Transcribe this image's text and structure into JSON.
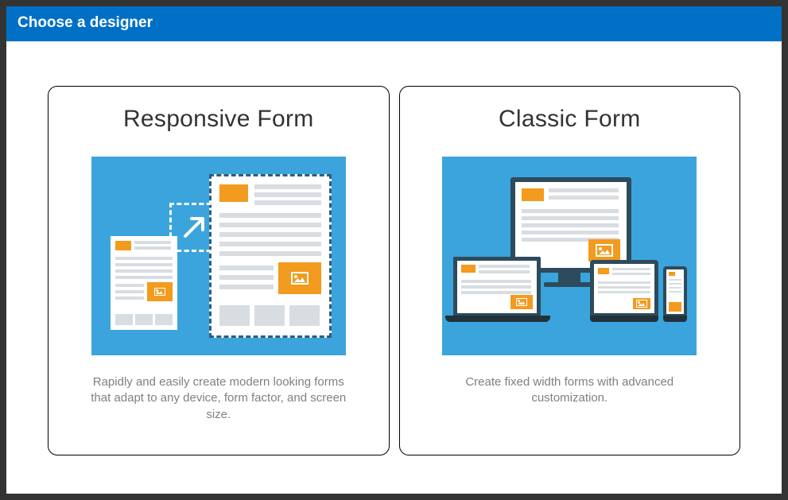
{
  "dialog": {
    "title": "Choose a designer"
  },
  "options": {
    "responsive": {
      "title": "Responsive Form",
      "description": "Rapidly and easily create modern looking forms that adapt to any device, form factor, and screen size."
    },
    "classic": {
      "title": "Classic Form",
      "description": "Create fixed width forms with advanced customization."
    }
  }
}
